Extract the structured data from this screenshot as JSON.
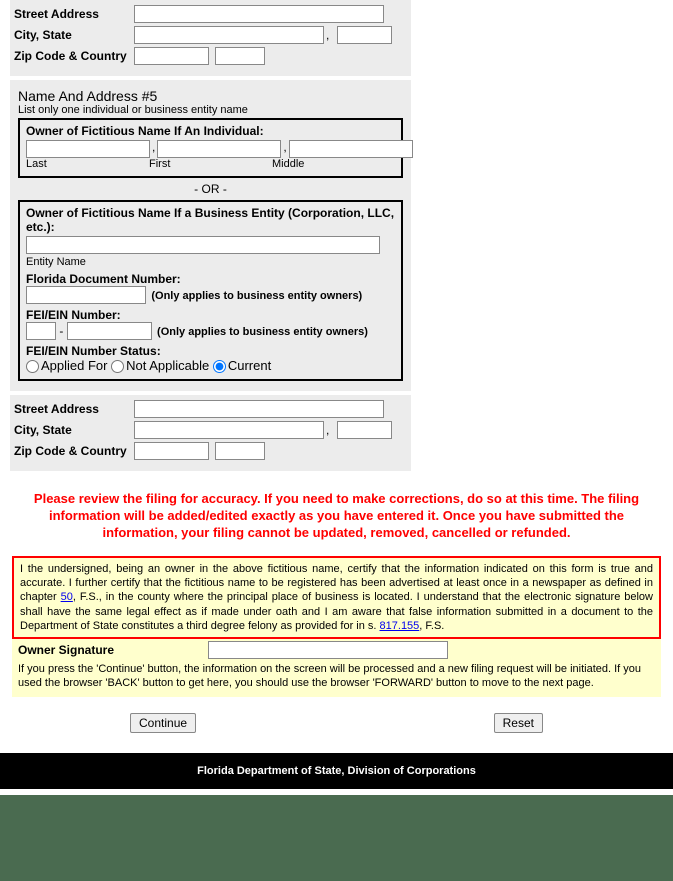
{
  "addr_labels": {
    "street": "Street Address",
    "city_state": "City, State",
    "zip_country": "Zip Code & Country"
  },
  "section5": {
    "title": "Name And Address #5",
    "sub": "List only one individual or business entity name"
  },
  "owner_individual": {
    "heading": "Owner of Fictitious Name If An Individual:",
    "last": "Last",
    "first": "First",
    "middle": "Middle"
  },
  "or": "- OR -",
  "owner_entity": {
    "heading": "Owner of Fictitious Name If a Business Entity (Corporation, LLC, etc.):",
    "entity_name": "Entity Name",
    "fl_doc": "Florida Document Number:",
    "help": "(Only applies to business entity owners)",
    "fei": "FEI/EIN Number:",
    "fei_status": "FEI/EIN Number Status:",
    "opt_applied": "Applied For",
    "opt_na": "Not Applicable",
    "opt_current": "Current"
  },
  "red_notice": "Please review the filing for accuracy. If you need to make corrections, do so at this time. The filing information will be added/edited exactly as you have entered it. Once you have submitted the information, your filing cannot be updated, removed, cancelled or refunded.",
  "cert": {
    "p1": "I the undersigned, being an owner in the above fictitious name, certify that the information indicated on this form is true and accurate. I further certify that the fictitious name to be registered has been advertised at least once in a newspaper as defined in chapter ",
    "link1": "50",
    "p2": ", F.S., in the county where the principal place of business is located. I understand that the electronic signature below shall have the same legal effect as if made under oath and I am aware that false information submitted in a document to the Department of State constitutes a third degree felony as provided for in s. ",
    "link2": "817.155",
    "p3": ", F.S."
  },
  "sig_label": "Owner Signature",
  "press_note": "If you press the 'Continue' button, the information on the screen will be processed and a new filing request will be initiated. If you used the browser 'BACK' button to get here, you should use the browser 'FORWARD' button to move to the next page.",
  "buttons": {
    "continue": "Continue",
    "reset": "Reset"
  },
  "footer": "Florida Department of State, Division of Corporations"
}
